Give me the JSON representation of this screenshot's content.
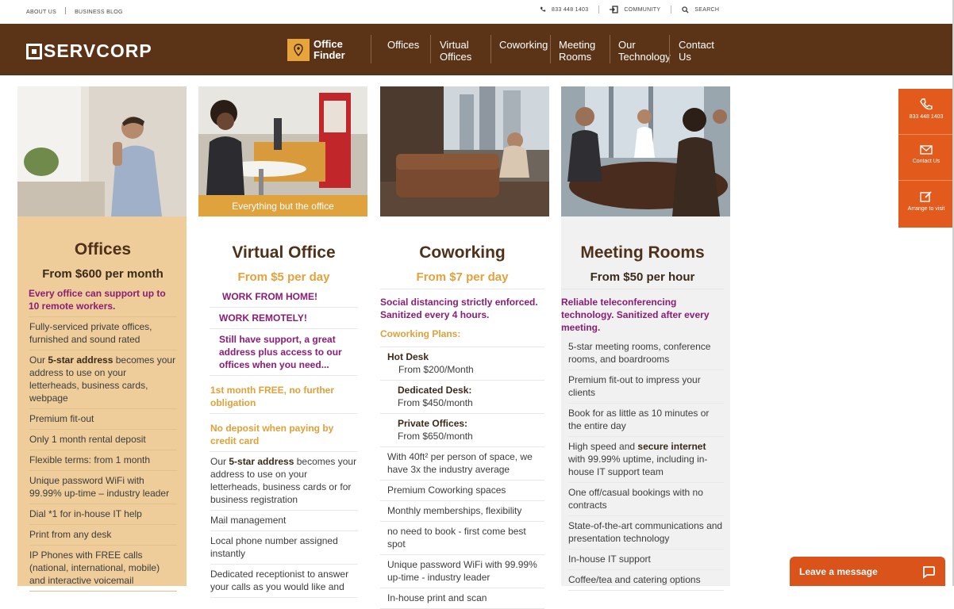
{
  "topbar": {
    "about": "ABOUT US",
    "blog": "BUSINESS BLOG",
    "phone": "833 448 1403",
    "community": "COMMUNITY",
    "search": "SEARCH"
  },
  "nav": {
    "logo": "SERVCORP",
    "finder_line1": "Office",
    "finder_line2": "Finder",
    "items": [
      {
        "l1": "Offices",
        "l2": ""
      },
      {
        "l1": "Virtual",
        "l2": "Offices"
      },
      {
        "l1": "Coworking",
        "l2": ""
      },
      {
        "l1": "Meeting",
        "l2": "Rooms"
      },
      {
        "l1": "Our",
        "l2": "Technology"
      },
      {
        "l1": "Contact",
        "l2": "Us"
      }
    ]
  },
  "offices": {
    "title": "Offices",
    "price": "From $600 per month",
    "highlight": "Every office can support up to 10 remote workers.",
    "items": [
      "Fully-serviced private offices, furnished and sound rated",
      "Premium fit-out",
      "Only 1 month rental deposit",
      "Flexible terms: from 1 month",
      "Unique password WiFi with 99.99% up-time – industry leader",
      "Dial *1 for in-house IT help",
      "Print from any desk",
      "IP Phones with FREE calls (national, international, mobile) and interactive voicemail"
    ],
    "address_pre": "Our ",
    "address_bold": "5-star address",
    "address_post": " becomes your address to use on your letterheads, business cards, webpage"
  },
  "virtual": {
    "caption": "Everything but the office",
    "title": "Virtual Office",
    "price": "From $5 per day",
    "p1": "WORK FROM HOME!",
    "p2": "WORK REMOTELY!",
    "p3": "Still have support, a great address plus access to our offices when you need...",
    "g1": "1st month FREE, no further obligation",
    "g2": "No deposit when paying by credit card",
    "address_pre": "Our ",
    "address_bold": "5-star address",
    "address_post": " becomes your address to use on your letterheads, business cards or for business registration",
    "items": [
      "Mail management",
      "Local phone number assigned instantly",
      "Dedicated receptionist to answer your calls as you would like and"
    ]
  },
  "coworking": {
    "title": "Coworking",
    "price": "From $7 per day",
    "highlight": "Social distancing strictly enforced. Sanitized every 4 hours.",
    "plans_label": "Coworking Plans:",
    "plans": [
      {
        "name": "Hot Desk",
        "price": "From $200/Month"
      },
      {
        "name": "Dedicated Desk:",
        "price": "From $450/month"
      },
      {
        "name": "Private Offices:",
        "price": "From $650/month"
      }
    ],
    "items": [
      "With 40ft² per person of space, we have 3x the industry average",
      "Premium Coworking spaces",
      "Monthly memberships, flexibility",
      "no need to book - first come best spot",
      "Unique password WiFi with 99.99% up-time - industry leader",
      "In-house print and scan"
    ]
  },
  "meeting": {
    "title": "Meeting Rooms",
    "price": "From $50 per hour",
    "highlight": "Reliable teleconferencing technology. Sanitized after every meeting.",
    "items": [
      "5-star meeting rooms, conference rooms, and boardrooms",
      "Premium fit-out to impress your clients",
      "Book for as little as 10 minutes or the entire day",
      "One off/casual bookings with no contracts",
      "State-of-the-art communications and presentation technology",
      "In-house IT support",
      "Coffee/tea and catering options"
    ],
    "net_pre": "High speed and ",
    "net_bold": "secure internet",
    "net_post": " with 99.99% uptime, including in-house IT support team"
  },
  "side": {
    "phone": "833 448 1403",
    "contact": "Contact Us",
    "visit": "Arrange to visit"
  },
  "chat": {
    "label": "Leave a message"
  },
  "colors": {
    "brown": "#5b3417",
    "gold": "#e0a23c",
    "orange": "#e25a1c",
    "purple": "#8a1d76"
  }
}
